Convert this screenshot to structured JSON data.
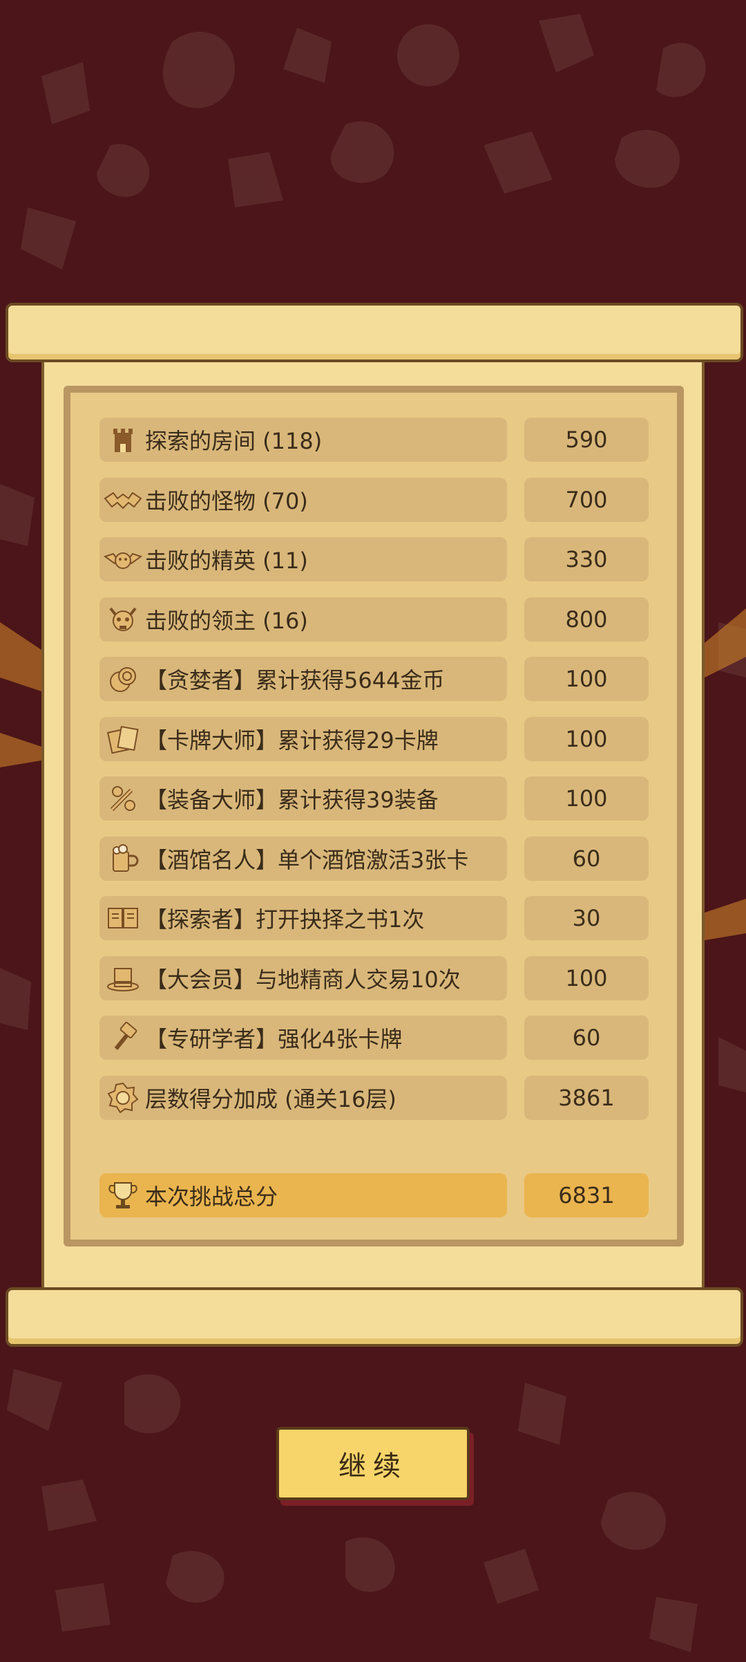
{
  "score_rows": [
    {
      "icon": "tower-icon",
      "label": "探索的房间 (118)",
      "value": "590"
    },
    {
      "icon": "bat-icon",
      "label": "击败的怪物 (70)",
      "value": "700"
    },
    {
      "icon": "winged-demon-icon",
      "label": "击败的精英 (11)",
      "value": "330"
    },
    {
      "icon": "horned-skull-icon",
      "label": "击败的领主 (16)",
      "value": "800"
    },
    {
      "icon": "coins-icon",
      "label": "【贪婪者】累计获得5644金币",
      "value": "100"
    },
    {
      "icon": "cards-icon",
      "label": "【卡牌大师】累计获得29卡牌",
      "value": "100"
    },
    {
      "icon": "equipment-icon",
      "label": "【装备大师】累计获得39装备",
      "value": "100"
    },
    {
      "icon": "beer-mug-icon",
      "label": "【酒馆名人】单个酒馆激活3张卡",
      "value": "60"
    },
    {
      "icon": "book-icon",
      "label": "【探索者】打开抉择之书1次",
      "value": "30"
    },
    {
      "icon": "top-hat-icon",
      "label": "【大会员】与地精商人交易10次",
      "value": "100"
    },
    {
      "icon": "hammer-icon",
      "label": "【专研学者】强化4张卡牌",
      "value": "60"
    },
    {
      "icon": "floor-badge-icon",
      "label": "层数得分加成 (通关16层)",
      "value": "3861"
    }
  ],
  "total": {
    "icon": "trophy-icon",
    "label": "本次挑战总分",
    "value": "6831"
  },
  "continue_label": "继续",
  "colors": {
    "background": "#4b1519",
    "parchment": "#f4dc9a",
    "row_fill": "#d9b77a",
    "total_fill": "#eab54f",
    "button": "#f7d56a"
  }
}
